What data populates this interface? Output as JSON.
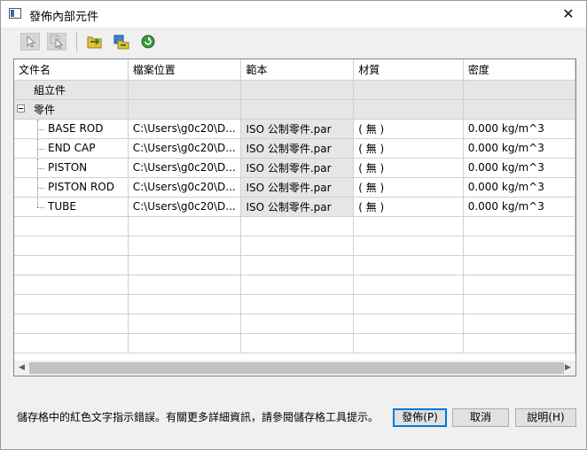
{
  "window": {
    "title": "發佈內部元件"
  },
  "toolbar": {
    "buttons": [
      {
        "icon": "select-pointer-icon",
        "enabled": false
      },
      {
        "icon": "select-add-icon",
        "enabled": false
      },
      {
        "icon": "folder-open-icon",
        "enabled": true
      },
      {
        "icon": "copy-to-folder-icon",
        "enabled": true
      },
      {
        "icon": "refresh-icon",
        "enabled": true
      }
    ]
  },
  "grid": {
    "columns": [
      "文件名",
      "檔案位置",
      "範本",
      "材質",
      "密度"
    ],
    "groups": {
      "assemblies": "組立件",
      "parts": "零件"
    },
    "parts": [
      {
        "name": "BASE ROD",
        "location": "C:\\Users\\g0c20\\D...",
        "template": "ISO 公制零件.par",
        "material": "( 無 )",
        "density": "0.000 kg/m^3"
      },
      {
        "name": "END CAP",
        "location": "C:\\Users\\g0c20\\D...",
        "template": "ISO 公制零件.par",
        "material": "( 無 )",
        "density": "0.000 kg/m^3"
      },
      {
        "name": "PISTON",
        "location": "C:\\Users\\g0c20\\D...",
        "template": "ISO 公制零件.par",
        "material": "( 無 )",
        "density": "0.000 kg/m^3"
      },
      {
        "name": "PISTON ROD",
        "location": "C:\\Users\\g0c20\\D...",
        "template": "ISO 公制零件.par",
        "material": "( 無 )",
        "density": "0.000 kg/m^3"
      },
      {
        "name": "TUBE",
        "location": "C:\\Users\\g0c20\\D...",
        "template": "ISO 公制零件.par",
        "material": "( 無 )",
        "density": "0.000 kg/m^3"
      }
    ]
  },
  "footer": {
    "message": "儲存格中的紅色文字指示錯誤。有關更多詳細資訊，請參閱儲存格工具提示。",
    "publish_label": "發佈(P)",
    "cancel_label": "取消",
    "help_label": "說明(H)"
  },
  "colors": {
    "accent": "#0078d7",
    "grid_line": "#d0d0d0",
    "cell_grey": "#e6e6e6"
  }
}
